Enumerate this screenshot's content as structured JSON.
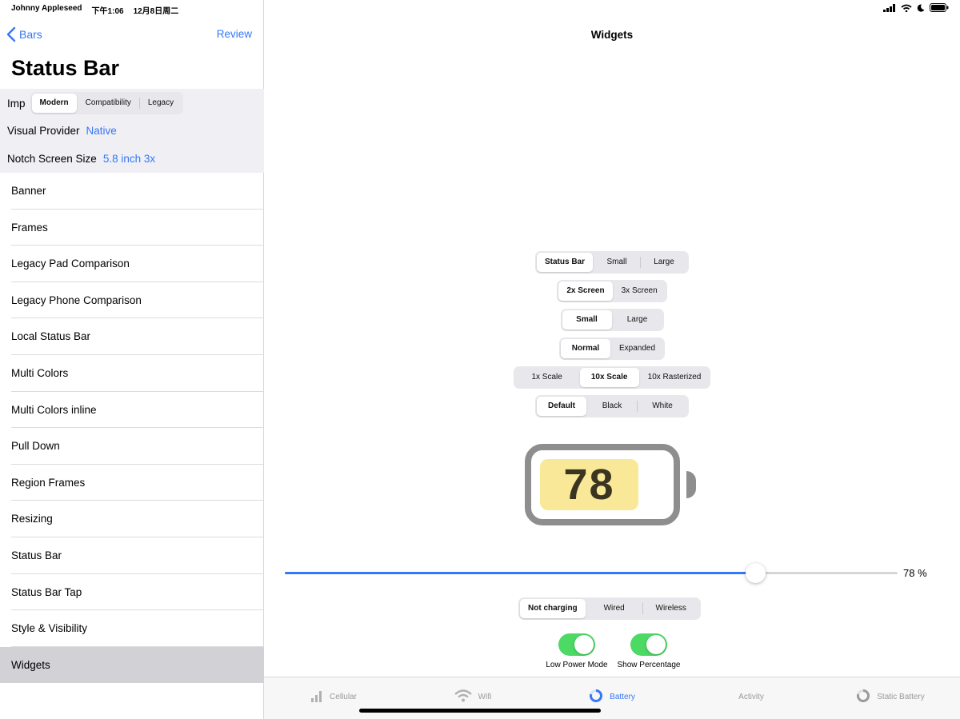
{
  "status_bar": {
    "name": "Johnny Appleseed",
    "time": "下午1:06",
    "date": "12月8日周二"
  },
  "sidebar": {
    "back_label": "Bars",
    "review_label": "Review",
    "title": "Status Bar",
    "imp": {
      "label": "Imp",
      "options": [
        "Modern",
        "Compatibility",
        "Legacy"
      ],
      "selected": "Modern"
    },
    "visual_provider": {
      "label": "Visual Provider",
      "value": "Native"
    },
    "notch_size": {
      "label": "Notch Screen Size",
      "value": "5.8 inch 3x"
    },
    "items": [
      "Banner",
      "Frames",
      "Legacy Pad Comparison",
      "Legacy Phone Comparison",
      "Local Status Bar",
      "Multi Colors",
      "Multi Colors inline",
      "Pull Down",
      "Region Frames",
      "Resizing",
      "Status Bar",
      "Status Bar Tap",
      "Style & Visibility",
      "Widgets"
    ],
    "active_item": "Widgets"
  },
  "main": {
    "title": "Widgets",
    "controls": [
      {
        "options": [
          "Status Bar",
          "Small",
          "Large"
        ],
        "selected": 0
      },
      {
        "options": [
          "2x Screen",
          "3x Screen"
        ],
        "selected": 0
      },
      {
        "options": [
          "Small",
          "Large"
        ],
        "selected": 0
      },
      {
        "options": [
          "Normal",
          "Expanded"
        ],
        "selected": 0
      },
      {
        "options": [
          "1x Scale",
          "10x Scale",
          "10x Rasterized"
        ],
        "selected": 1
      },
      {
        "options": [
          "Default",
          "Black",
          "White"
        ],
        "selected": 0
      }
    ],
    "battery_text": "78",
    "battery_level": 78,
    "slider_label": "78 %",
    "charging": {
      "options": [
        "Not charging",
        "Wired",
        "Wireless"
      ],
      "selected": 0
    },
    "toggles": [
      {
        "label": "Low Power Mode",
        "on": true
      },
      {
        "label": "Show Percentage",
        "on": true
      }
    ]
  },
  "tabs": [
    {
      "label": "Cellular",
      "icon": "cellular-icon",
      "selected": false
    },
    {
      "label": "Wifi",
      "icon": "wifi-icon",
      "selected": false
    },
    {
      "label": "Battery",
      "icon": "battery-ring-icon",
      "selected": true
    },
    {
      "label": "Activity",
      "icon": "",
      "selected": false
    },
    {
      "label": "Static Battery",
      "icon": "static-battery-icon",
      "selected": false
    }
  ],
  "colors": {
    "accent": "#3478f6",
    "switch_on": "#4cd964",
    "battery_fill": "#f8e898"
  }
}
